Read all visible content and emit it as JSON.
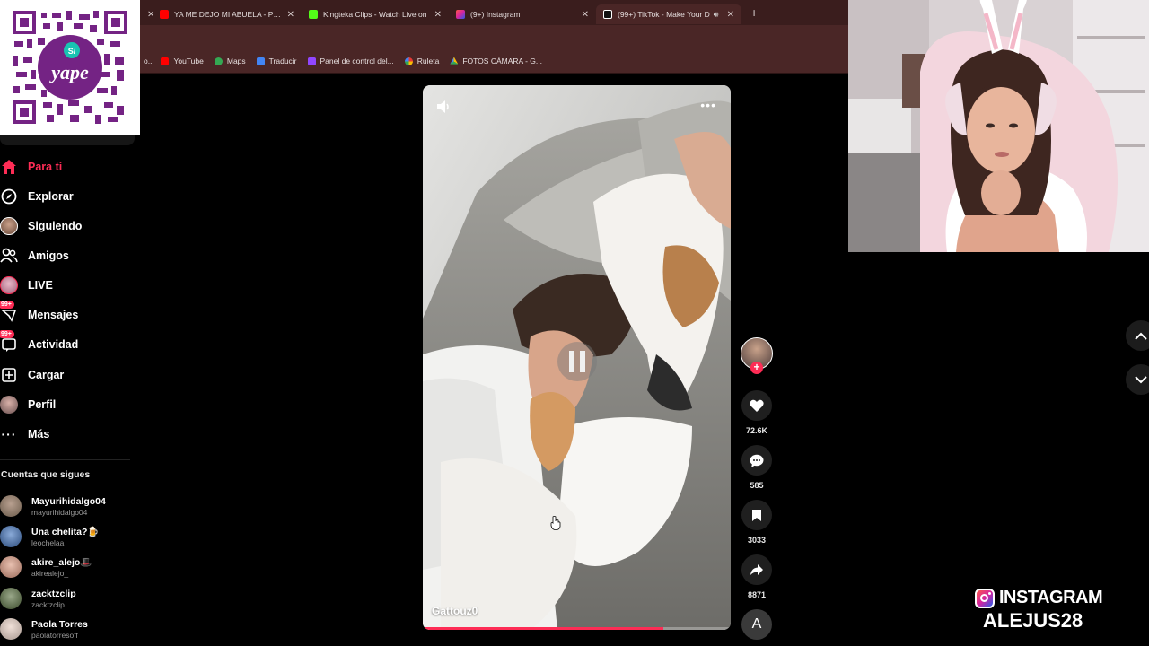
{
  "browser": {
    "tabs": [
      {
        "label": "",
        "favicon": "partial-tab-icon",
        "color": "#888888"
      },
      {
        "label": "YA ME DEJO MI ABUELA - PIUR",
        "favicon": "youtube-icon",
        "color": "#ff0000"
      },
      {
        "label": "Kingteka Clips - Watch Live on",
        "favicon": "kick-icon",
        "color": "#53fc18"
      },
      {
        "label": "(9+) Instagram",
        "favicon": "instagram-icon",
        "color": "#d6249f"
      },
      {
        "label": "(99+) TikTok - Make Your D",
        "favicon": "tiktok-icon",
        "color": "#ffffff",
        "active": true
      }
    ],
    "bookmarks": [
      {
        "label": "YouTube",
        "icon": "youtube-icon",
        "color": "#ff0000"
      },
      {
        "label": "Maps",
        "icon": "maps-pin-icon",
        "color": "#34a853"
      },
      {
        "label": "Traducir",
        "icon": "translate-icon",
        "color": "#4285f4"
      },
      {
        "label": "Panel de control del...",
        "icon": "panel-icon",
        "color": "#9146ff"
      },
      {
        "label": "Ruleta",
        "icon": "roulette-icon",
        "color": "#e53935"
      },
      {
        "label": "FOTOS CÁMARA - G...",
        "icon": "drive-icon",
        "color": "#fbbc04"
      }
    ]
  },
  "qr": {
    "brand": "yape",
    "brand_color": "#742384"
  },
  "sidebar": {
    "nav": [
      {
        "label": "Para ti",
        "icon": "home-icon",
        "active": true
      },
      {
        "label": "Explorar",
        "icon": "compass-icon"
      },
      {
        "label": "Siguiendo",
        "icon": "following-avatar-icon"
      },
      {
        "label": "Amigos",
        "icon": "friends-icon"
      },
      {
        "label": "LIVE",
        "icon": "live-avatar-icon"
      },
      {
        "label": "Mensajes",
        "icon": "messages-icon",
        "badge": "99+"
      },
      {
        "label": "Actividad",
        "icon": "activity-icon",
        "badge": "99+"
      },
      {
        "label": "Cargar",
        "icon": "upload-icon"
      },
      {
        "label": "Perfil",
        "icon": "profile-avatar-icon"
      },
      {
        "label": "Más",
        "icon": "more-dots-icon"
      }
    ],
    "following_title": "Cuentas que sigues",
    "following": [
      {
        "name": "Mayurihidalgo04",
        "username": "mayurihidalgo04",
        "color": "#8a7a6a"
      },
      {
        "name": "Una chelita?🍺",
        "username": "leochelaa",
        "color": "#3b5a8a"
      },
      {
        "name": "akire_alejo🎩",
        "username": "akirealejo_",
        "color": "#c89a8a"
      },
      {
        "name": "zacktzclip",
        "username": "zacktzclip",
        "color": "#5a6a4a"
      },
      {
        "name": "Paola Torres",
        "username": "paolatorresoff",
        "color": "#d8c8c0"
      }
    ]
  },
  "video": {
    "author": "Gattouz0",
    "progress": 0.78,
    "actions": {
      "likes": "72.6K",
      "comments": "585",
      "saves": "3033",
      "shares": "8871",
      "audio_label": "A"
    }
  },
  "overlay": {
    "platform": "INSTAGRAM",
    "handle": "ALEJUS28"
  }
}
